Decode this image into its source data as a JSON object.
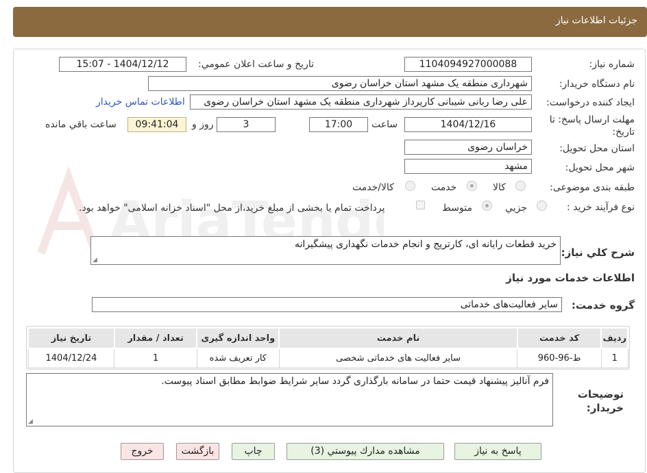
{
  "header": {
    "title": "جزئيات اطلاعات نياز"
  },
  "watermark": {
    "text": "AriaTender.neT"
  },
  "fields": {
    "need_number": {
      "label": "شماره نياز:",
      "value": "1104094927000088"
    },
    "announce_datetime": {
      "label": "تاريخ و ساعت اعلان عمومي:",
      "value": "1404/12/12 - 15:07"
    },
    "buyer_org": {
      "label": "نام دستگاه خريدار:",
      "value": "شهرداری منطقه یک مشهد استان خراسان رضوی"
    },
    "requester": {
      "label": "ايجاد كننده درخواست:",
      "value": "علی رضا ربانی شیبانی کارپرداز شهرداری منطقه یک مشهد استان خراسان رضوی"
    },
    "buyer_contact_link": "اطلاعات تماس خريدار",
    "deadline": {
      "label": "مهلت ارسال پاسخ: تا تاريخ:",
      "date": "1404/12/16",
      "time_label": "ساعت",
      "time": "17:00",
      "days": "3",
      "days_label": "روز و",
      "remaining": "09:41:04",
      "remaining_label": "ساعت باقي مانده"
    },
    "delivery_province": {
      "label": "استان محل تحويل:",
      "value": "خراسان رضوی"
    },
    "delivery_city": {
      "label": "شهر محل تحويل:",
      "value": "مشهد"
    },
    "category": {
      "label": "طبقه بندی موضوعی:",
      "options": [
        "كالا",
        "خدمت",
        "كالا/خدمت"
      ],
      "selected": "خدمت"
    },
    "purchase_process": {
      "label": "نوع فرآيند خريد :",
      "options": [
        "جزيي",
        "متوسط"
      ],
      "selected": "متوسط",
      "note": "پرداخت تمام یا بخشی از مبلغ خرید،از محل \"اسناد خزانه اسلامی\" خواهد بود."
    },
    "description": {
      "label": "شرح كلي نياز:",
      "value": "خرید قطعات رایانه ای، کارتریج و انجام خدمات نگهداری پیشگیرانه"
    }
  },
  "services": {
    "section_title": "اطلاعات خدمات مورد نياز",
    "group_label": "گروه خدمت:",
    "group_value": "سایر فعالیت‌های خدماتی",
    "columns": [
      "رديف",
      "كد خدمت",
      "نام خدمت",
      "واحد اندازه گيری",
      "تعداد / مقدار",
      "تاريخ نياز"
    ],
    "rows": [
      [
        "1",
        "ط-96-960",
        "سایر فعالیت های خدماتی شخصی",
        "کار تعریف شده",
        "1",
        "1404/12/24"
      ]
    ]
  },
  "buyer_notes": {
    "label": "توضيحات خريدار:",
    "value": "فرم آنالیز پیشنهاد قیمت حتما در سامانه بارگذاری گردد سایر شرایط ضوابط مطابق اسناد پیوست."
  },
  "buttons": {
    "reply": "پاسخ به نياز",
    "attachments": "مشاهده مدارك پيوستي (3)",
    "print": "چاپ",
    "back": "بازگشت",
    "exit": "خروج"
  },
  "colors": {
    "header": "#8b6a3f",
    "link": "#2a56c6",
    "remaining_bg": "#fbf5d4",
    "green_btn": "#e6f4e1",
    "pink_btn": "#fbe4e4"
  }
}
